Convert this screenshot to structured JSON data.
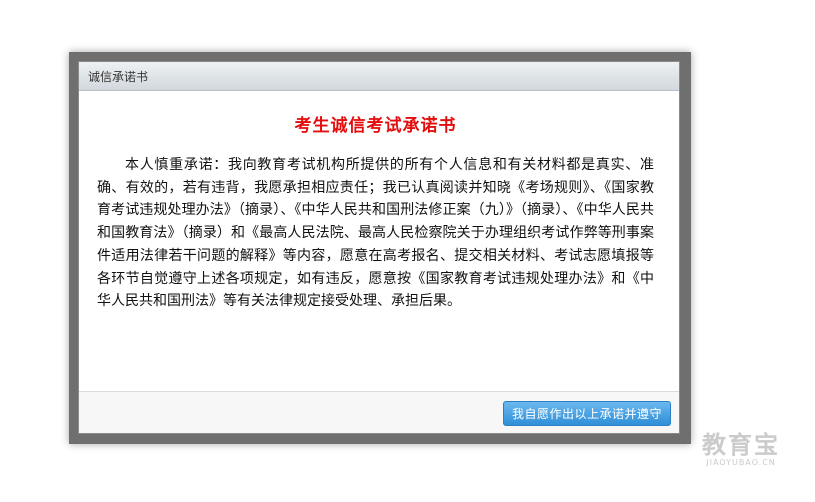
{
  "dialog": {
    "title": "诚信承诺书",
    "heading": "考生诚信考试承诺书",
    "paragraph": "本人慎重承诺：我向教育考试机构所提供的所有个人信息和有关材料都是真实、准确、有效的，若有违背，我愿承担相应责任；我已认真阅读并知晓《考场规则》、《国家教育考试违规处理办法》（摘录）、《中华人民共和国刑法修正案（九）》（摘录）、《中华人民共和国教育法》（摘录）和《最高人民法院、最高人民检察院关于办理组织考试作弊等刑事案件适用法律若干问题的解释》等内容，愿意在高考报名、提交相关材料、考试志愿填报等各环节自觉遵守上述各项规定，如有违反，愿意按《国家教育考试违规处理办法》和《中华人民共和国刑法》等有关法律规定接受处理、承担后果。",
    "agree_button": "我自愿作出以上承诺并遵守"
  },
  "watermark": {
    "cn": "教育宝",
    "en": "JIAOYUBAO.CN"
  },
  "colors": {
    "heading": "#e30d0d",
    "button": "#2f8fd8",
    "frame": "#6f6f6f"
  }
}
